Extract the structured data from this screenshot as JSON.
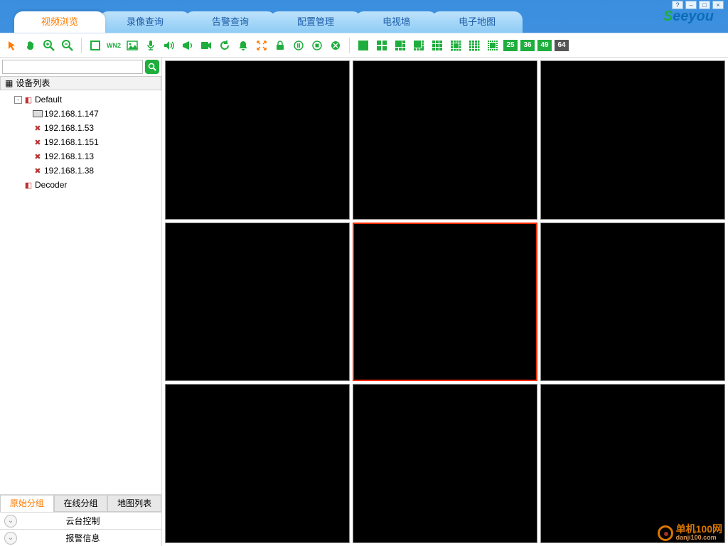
{
  "window": {
    "min": "–",
    "max": "□",
    "close": "×",
    "help": "?"
  },
  "logo": {
    "first": "S",
    "rest": "eeyou"
  },
  "tabs": [
    {
      "label": "视频浏览",
      "active": true
    },
    {
      "label": "录像查询",
      "active": false
    },
    {
      "label": "告警查询",
      "active": false
    },
    {
      "label": "配置管理",
      "active": false
    },
    {
      "label": "电视墙",
      "active": false
    },
    {
      "label": "电子地图",
      "active": false
    }
  ],
  "toolbar": {
    "win2": "WN2",
    "numlayouts": [
      "25",
      "36",
      "49",
      "64"
    ]
  },
  "sidebar": {
    "search_placeholder": "",
    "tree_title": "设备列表",
    "root": [
      {
        "label": "Default",
        "expanded": true,
        "children": [
          {
            "label": "192.168.1.147",
            "type": "dvr"
          },
          {
            "label": "192.168.1.53",
            "type": "cam"
          },
          {
            "label": "192.168.1.151",
            "type": "cam"
          },
          {
            "label": "192.168.1.13",
            "type": "cam"
          },
          {
            "label": "192.168.1.38",
            "type": "cam"
          }
        ]
      },
      {
        "label": "Decoder",
        "expanded": false
      }
    ],
    "subtabs": [
      {
        "label": "原始分组",
        "active": true
      },
      {
        "label": "在线分组",
        "active": false
      },
      {
        "label": "地图列表",
        "active": false
      }
    ],
    "accordion": [
      {
        "label": "云台控制"
      },
      {
        "label": "报警信息"
      }
    ]
  },
  "videogrid": {
    "rows": 3,
    "cols": 3,
    "selected_index": 4
  },
  "watermark": {
    "title": "单机100网",
    "sub": "danji100.com"
  }
}
